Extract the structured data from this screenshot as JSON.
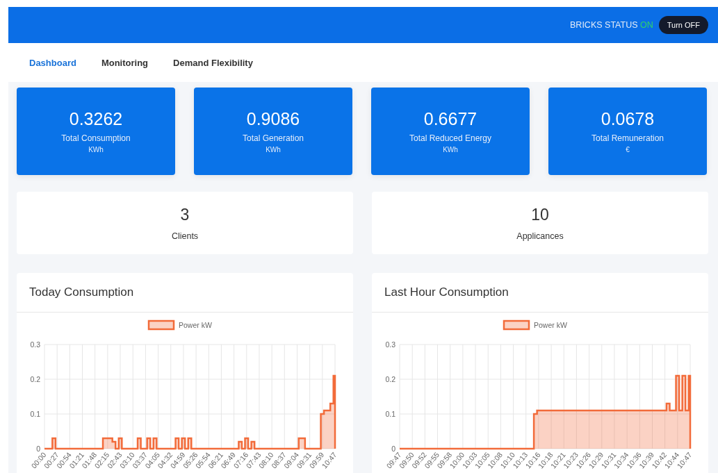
{
  "header": {
    "status_label": "BRICKS STATUS",
    "status_value": "ON",
    "on": true,
    "button": "Turn OFF"
  },
  "tabs": [
    {
      "label": "Dashboard",
      "selected": true
    },
    {
      "label": "Monitoring",
      "selected": false
    },
    {
      "label": "Demand Flexibility",
      "selected": false
    }
  ],
  "stats": [
    {
      "value": "0.3262",
      "label": "Total Consumption",
      "unit": "KWh"
    },
    {
      "value": "0.9086",
      "label": "Total Generation",
      "unit": "KWh"
    },
    {
      "value": "0.6677",
      "label": "Total Reduced Energy",
      "unit": "KWh"
    },
    {
      "value": "0.0678",
      "label": "Total Remuneration",
      "unit": "€"
    }
  ],
  "counts": [
    {
      "value": "3",
      "label": "Clients"
    },
    {
      "value": "10",
      "label": "Applicances"
    }
  ],
  "charts": [
    {
      "title": "Today Consumption",
      "chart_data": {
        "type": "area",
        "grid": true,
        "ylim": [
          0,
          0.3
        ],
        "yticks": [
          {
            "value": 0,
            "label": "0"
          },
          {
            "value": 0.1,
            "label": "0.1"
          },
          {
            "value": 0.2,
            "label": "0.2"
          },
          {
            "value": 0.3,
            "label": "0.3"
          }
        ],
        "categories": [
          "00:00",
          null,
          null,
          null,
          "00:27",
          null,
          null,
          null,
          "00:54",
          null,
          null,
          null,
          "01:21",
          null,
          null,
          null,
          "01:48",
          null,
          null,
          null,
          "02:15",
          null,
          null,
          null,
          "02:43",
          null,
          null,
          null,
          "03:10",
          null,
          null,
          null,
          "03:37",
          null,
          null,
          null,
          "04:05",
          null,
          null,
          null,
          "04:32",
          null,
          null,
          null,
          "04:59",
          null,
          null,
          null,
          "05:26",
          null,
          null,
          null,
          "05:54",
          null,
          null,
          null,
          "06:21",
          null,
          null,
          null,
          "06:49",
          null,
          null,
          null,
          "07:16",
          null,
          null,
          null,
          "07:43",
          null,
          null,
          null,
          "08:10",
          null,
          null,
          null,
          "08:37",
          null,
          null,
          null,
          "09:04",
          null,
          null,
          null,
          "09:31",
          null,
          null,
          null,
          "09:59",
          null,
          null,
          null,
          "10:47"
        ],
        "series": [
          {
            "name": "Power kW",
            "color": "#f26b3a",
            "values": [
              0,
              0,
              0,
              0.03,
              0,
              0,
              0,
              0,
              0,
              0,
              0,
              0,
              0,
              0,
              0,
              0,
              0,
              0,
              0,
              0.03,
              0.03,
              0.03,
              0.02,
              0,
              0.03,
              0,
              0,
              0,
              0,
              0,
              0.03,
              0,
              0,
              0.03,
              0,
              0.03,
              0,
              0,
              0,
              0,
              0,
              0,
              0.03,
              0,
              0.03,
              0,
              0.03,
              0,
              0,
              0,
              0,
              0,
              0,
              0,
              0,
              0,
              0,
              0,
              0,
              0,
              0,
              0,
              0.02,
              0,
              0.03,
              0,
              0.02,
              0,
              0,
              0,
              0,
              0,
              0,
              0,
              0,
              0,
              0,
              0,
              0,
              0,
              0,
              0.03,
              0.03,
              0,
              0,
              0,
              0,
              0,
              0.1,
              0.11,
              0.11,
              0.13,
              0.21
            ]
          }
        ]
      }
    },
    {
      "title": "Last Hour Consumption",
      "chart_data": {
        "type": "area",
        "grid": true,
        "ylim": [
          0,
          0.3
        ],
        "yticks": [
          {
            "value": 0,
            "label": "0"
          },
          {
            "value": 0.1,
            "label": "0.1"
          },
          {
            "value": 0.2,
            "label": "0.2"
          },
          {
            "value": 0.3,
            "label": "0.3"
          }
        ],
        "categories": [
          "09:47",
          null,
          null,
          null,
          "09:50",
          null,
          null,
          null,
          "09:52",
          null,
          null,
          null,
          "09:55",
          null,
          null,
          null,
          "09:58",
          null,
          null,
          null,
          "10:00",
          null,
          null,
          null,
          "10:03",
          null,
          null,
          null,
          "10:05",
          null,
          null,
          null,
          "10:08",
          null,
          null,
          null,
          "10:10",
          null,
          null,
          null,
          "10:13",
          null,
          null,
          null,
          "10:16",
          null,
          null,
          null,
          "10:18",
          null,
          null,
          null,
          "10:21",
          null,
          null,
          null,
          "10:23",
          null,
          null,
          null,
          "10:26",
          null,
          null,
          null,
          "10:29",
          null,
          null,
          null,
          "10:31",
          null,
          null,
          null,
          "10:34",
          null,
          null,
          null,
          "10:36",
          null,
          null,
          null,
          "10:39",
          null,
          null,
          null,
          "10:42",
          null,
          null,
          null,
          "10:44",
          null,
          null,
          null,
          "10:47"
        ],
        "series": [
          {
            "name": "Power kW",
            "color": "#f26b3a",
            "values": [
              0,
              0,
              0,
              0,
              0,
              0,
              0,
              0,
              0,
              0,
              0,
              0,
              0,
              0,
              0,
              0,
              0,
              0,
              0,
              0,
              0,
              0,
              0,
              0,
              0,
              0,
              0,
              0,
              0,
              0,
              0,
              0,
              0,
              0,
              0,
              0,
              0,
              0,
              0,
              0,
              0,
              0,
              0,
              0.1,
              0.11,
              0.11,
              0.11,
              0.11,
              0.11,
              0.11,
              0.11,
              0.11,
              0.11,
              0.11,
              0.11,
              0.11,
              0.11,
              0.11,
              0.11,
              0.11,
              0.11,
              0.11,
              0.11,
              0.11,
              0.11,
              0.11,
              0.11,
              0.11,
              0.11,
              0.11,
              0.11,
              0.11,
              0.11,
              0.11,
              0.11,
              0.11,
              0.11,
              0.11,
              0.11,
              0.11,
              0.11,
              0.11,
              0.11,
              0.11,
              0.11,
              0.13,
              0.11,
              0.11,
              0.21,
              0.11,
              0.21,
              0.11,
              0.21
            ]
          }
        ]
      }
    }
  ]
}
